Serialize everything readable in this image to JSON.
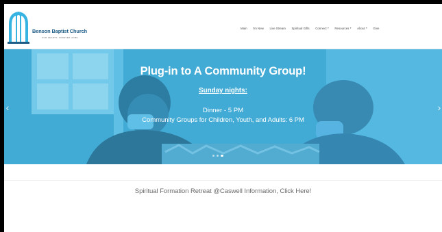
{
  "site": {
    "name": "Benson Baptist Church",
    "tagline": "OUR HEARTS. FOREVER HOME."
  },
  "nav": {
    "items": [
      {
        "label": "Main",
        "has_caret": false
      },
      {
        "label": "I'm New",
        "has_caret": false
      },
      {
        "label": "Live Stream",
        "has_caret": false
      },
      {
        "label": "Spiritual Gifts",
        "has_caret": false
      },
      {
        "label": "Connect",
        "has_caret": true
      },
      {
        "label": "Resources",
        "has_caret": true
      },
      {
        "label": "About",
        "has_caret": true
      },
      {
        "label": "Give",
        "has_caret": false
      }
    ]
  },
  "hero": {
    "title": "Plug-in to A Community Group!",
    "subtitle": "Sunday nights:",
    "line1": "Dinner - 5 PM",
    "line2": "Community Groups for Children, Youth, and Adults: 6 PM",
    "overlay_color": "#46b9e6",
    "slides": 3,
    "active_slide": 2
  },
  "content": {
    "retreat_link": "Spiritual Formation Retreat @Caswell Information, Click Here!"
  },
  "colors": {
    "brand_blue": "#1f5d86",
    "logo_cyan": "#36b3e0",
    "nav_text": "#4a4a4a"
  }
}
